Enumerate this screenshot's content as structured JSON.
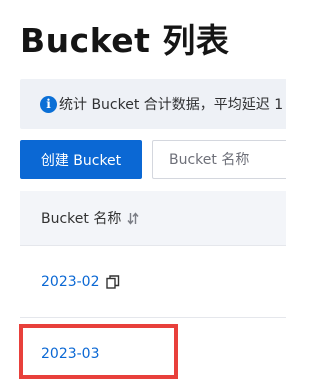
{
  "page": {
    "title": "Bucket 列表"
  },
  "info_banner": {
    "icon": "info-circle-icon",
    "icon_glyph": "i",
    "text": "统计 Bucket 合计数据，平均延迟 1"
  },
  "toolbar": {
    "create_label": "创建 Bucket",
    "search_placeholder": "Bucket 名称"
  },
  "table": {
    "header": {
      "label": "Bucket 名称",
      "sort_icon": "sort-icon"
    },
    "rows": [
      {
        "name": "2023-02",
        "icon": "copy-icon"
      },
      {
        "name": "2023-03"
      }
    ]
  },
  "colors": {
    "primary": "#0b68d4",
    "highlight": "#e8403b",
    "banner_bg": "#eef1f6",
    "header_bg": "#f3f5f9"
  }
}
